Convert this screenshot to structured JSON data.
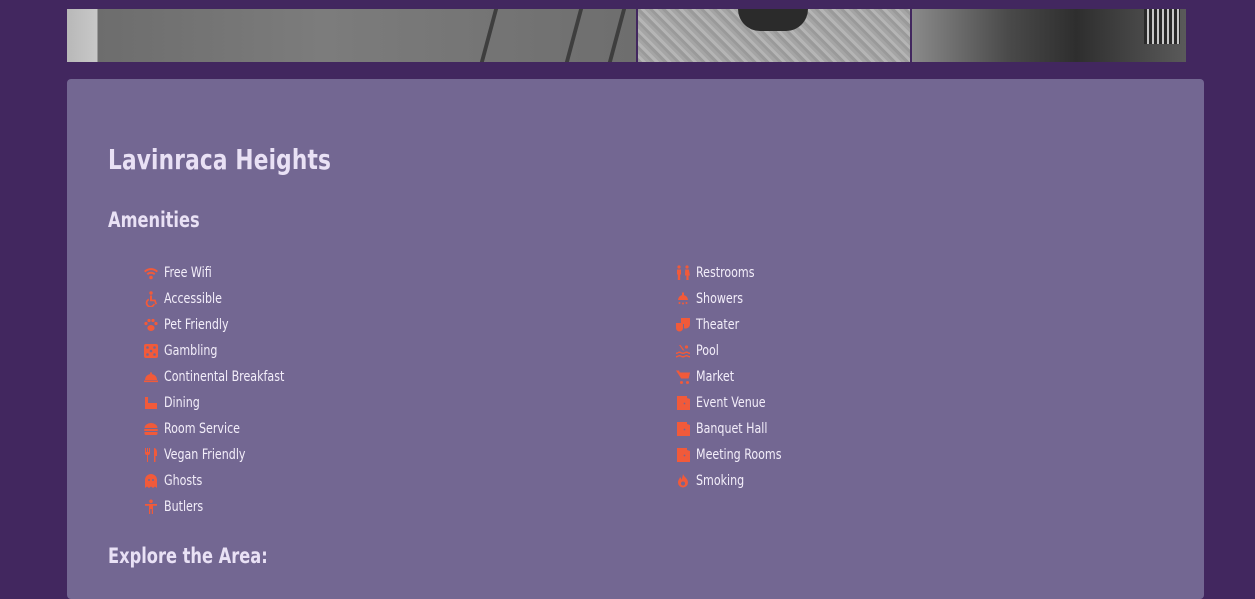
{
  "hotel": {
    "name": "Lavinraca Heights",
    "amenities_heading": "Amenities",
    "explore_heading": "Explore the Area:"
  },
  "colors": {
    "background": "#42275f",
    "card": "#736792",
    "accent": "#f15a3a",
    "text": "#f3eefa"
  },
  "amenities_left": [
    {
      "label": "Free Wifi",
      "icon": "wifi-icon"
    },
    {
      "label": "Accessible",
      "icon": "wheelchair-icon"
    },
    {
      "label": "Pet Friendly",
      "icon": "paw-icon"
    },
    {
      "label": "Gambling",
      "icon": "dice-icon"
    },
    {
      "label": "Continental Breakfast",
      "icon": "cloche-icon"
    },
    {
      "label": "Dining",
      "icon": "dining-icon"
    },
    {
      "label": "Room Service",
      "icon": "burger-icon"
    },
    {
      "label": "Vegan Friendly",
      "icon": "utensils-icon"
    },
    {
      "label": "Ghosts",
      "icon": "ghost-icon"
    },
    {
      "label": "Butlers",
      "icon": "person-icon"
    }
  ],
  "amenities_right": [
    {
      "label": "Restrooms",
      "icon": "restroom-icon"
    },
    {
      "label": "Showers",
      "icon": "shower-icon"
    },
    {
      "label": "Theater",
      "icon": "theater-masks-icon"
    },
    {
      "label": "Pool",
      "icon": "pool-icon"
    },
    {
      "label": "Market",
      "icon": "cart-icon"
    },
    {
      "label": "Event Venue",
      "icon": "door-icon"
    },
    {
      "label": "Banquet Hall",
      "icon": "door-icon"
    },
    {
      "label": "Meeting Rooms",
      "icon": "door-icon"
    },
    {
      "label": "Smoking",
      "icon": "fire-icon"
    }
  ]
}
